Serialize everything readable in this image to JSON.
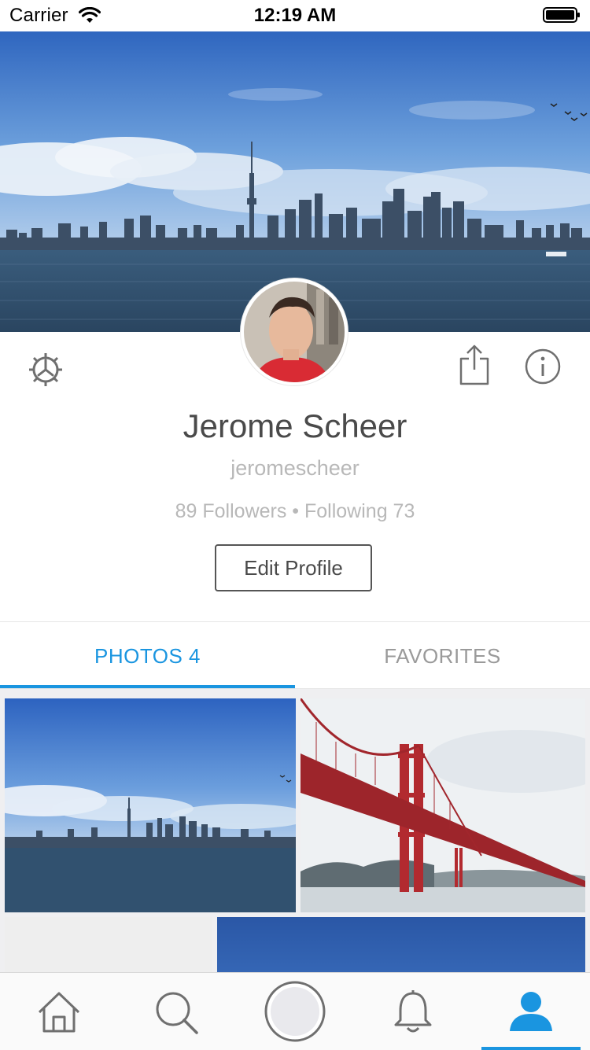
{
  "status_bar": {
    "carrier": "Carrier",
    "time": "12:19 AM"
  },
  "profile": {
    "name": "Jerome Scheer",
    "username": "jeromescheer",
    "stats": "89 Followers • Following 73",
    "edit_button": "Edit Profile"
  },
  "tabs": [
    {
      "label": "PHOTOS 4",
      "active": true
    },
    {
      "label": "FAVORITES",
      "active": false
    }
  ],
  "colors": {
    "accent": "#1a95e0",
    "text_primary": "#4a4a4a",
    "text_secondary": "#b8b8b8",
    "tab_inactive": "#9a9a9a"
  },
  "icons": {
    "settings": "gear-icon",
    "share": "share-icon",
    "info": "info-icon",
    "home": "home-icon",
    "search": "search-icon",
    "capture": "camera-capture-icon",
    "notifications": "bell-icon",
    "profile": "user-icon"
  }
}
